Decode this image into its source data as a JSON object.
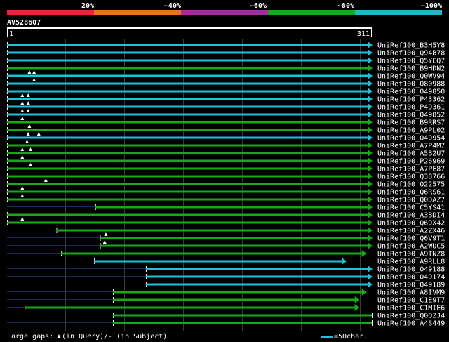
{
  "identity_scale": {
    "labels": [
      "20%",
      "~40%",
      "~60%",
      "~80%",
      "~100%"
    ],
    "colors": [
      "#e8243c",
      "#e07820",
      "#a02ca0",
      "#18a818",
      "#20b8c8"
    ]
  },
  "query": {
    "name": "AV528607",
    "start_label": "1",
    "end_label": "311",
    "length": 311
  },
  "hits": [
    {
      "name": "UniRef100_B3H5Y8",
      "start": 1,
      "end": 311,
      "color": "cyan",
      "arrow": true,
      "gaps": []
    },
    {
      "name": "UniRef100_Q94B78",
      "start": 1,
      "end": 311,
      "color": "cyan",
      "arrow": true,
      "gaps": []
    },
    {
      "name": "UniRef100_Q5YEQ7",
      "start": 1,
      "end": 311,
      "color": "cyan",
      "arrow": true,
      "gaps": []
    },
    {
      "name": "UniRef100_B9HDN2",
      "start": 1,
      "end": 311,
      "color": "green",
      "arrow": true,
      "gaps": []
    },
    {
      "name": "UniRef100_Q0WV94",
      "start": 1,
      "end": 311,
      "color": "cyan",
      "arrow": true,
      "gaps": [
        20,
        24
      ]
    },
    {
      "name": "UniRef100_O80988",
      "start": 1,
      "end": 311,
      "color": "cyan",
      "arrow": true,
      "gaps": [
        24
      ]
    },
    {
      "name": "UniRef100_O49850",
      "start": 1,
      "end": 311,
      "color": "cyan",
      "arrow": true,
      "gaps": []
    },
    {
      "name": "UniRef100_P43362",
      "start": 1,
      "end": 311,
      "color": "cyan",
      "arrow": true,
      "gaps": [
        14,
        19
      ]
    },
    {
      "name": "UniRef100_P49361",
      "start": 1,
      "end": 311,
      "color": "cyan",
      "arrow": true,
      "gaps": [
        14,
        19
      ]
    },
    {
      "name": "UniRef100_O49852",
      "start": 1,
      "end": 311,
      "color": "cyan",
      "arrow": true,
      "gaps": [
        14,
        19
      ]
    },
    {
      "name": "UniRef100_B9RRS7",
      "start": 1,
      "end": 311,
      "color": "green",
      "arrow": true,
      "gaps": [
        14
      ]
    },
    {
      "name": "UniRef100_A9PL02",
      "start": 1,
      "end": 311,
      "color": "green",
      "arrow": true,
      "gaps": [
        20
      ]
    },
    {
      "name": "UniRef100_O49954",
      "start": 1,
      "end": 311,
      "color": "cyan",
      "arrow": true,
      "gaps": [
        19,
        28
      ]
    },
    {
      "name": "UniRef100_A7P4M7",
      "start": 1,
      "end": 311,
      "color": "green",
      "arrow": true,
      "gaps": [
        18
      ]
    },
    {
      "name": "UniRef100_A5B2U7",
      "start": 1,
      "end": 311,
      "color": "green",
      "arrow": true,
      "gaps": [
        14,
        21
      ]
    },
    {
      "name": "UniRef100_P26969",
      "start": 1,
      "end": 311,
      "color": "green",
      "arrow": true,
      "gaps": [
        14
      ]
    },
    {
      "name": "UniRef100_A7PE87",
      "start": 1,
      "end": 311,
      "color": "green",
      "arrow": true,
      "gaps": [
        21
      ]
    },
    {
      "name": "UniRef100_Q38766",
      "start": 1,
      "end": 311,
      "color": "green",
      "arrow": true,
      "gaps": []
    },
    {
      "name": "UniRef100_O22575",
      "start": 1,
      "end": 311,
      "color": "green",
      "arrow": true,
      "gaps": [
        34
      ]
    },
    {
      "name": "UniRef100_Q6RS61",
      "start": 1,
      "end": 311,
      "color": "green",
      "arrow": true,
      "gaps": [
        14
      ]
    },
    {
      "name": "UniRef100_Q0DAZ7",
      "start": 1,
      "end": 311,
      "color": "green",
      "arrow": true,
      "gaps": [
        14
      ]
    },
    {
      "name": "UniRef100_C5YS41",
      "start": 76,
      "end": 311,
      "color": "green",
      "arrow": true,
      "gaps": []
    },
    {
      "name": "UniRef100_A3BDI4",
      "start": 1,
      "end": 311,
      "color": "green",
      "arrow": true,
      "gaps": []
    },
    {
      "name": "UniRef100_Q69X42",
      "start": 1,
      "end": 311,
      "color": "green",
      "arrow": true,
      "gaps": [
        14
      ]
    },
    {
      "name": "UniRef100_A2ZX46",
      "start": 43,
      "end": 311,
      "color": "green",
      "arrow": true,
      "gaps": []
    },
    {
      "name": "UniRef100_Q6V9T1",
      "start": 80,
      "end": 311,
      "color": "green",
      "arrow": true,
      "gaps": [
        85
      ]
    },
    {
      "name": "UniRef100_A2WUC5",
      "start": 80,
      "end": 311,
      "color": "green",
      "arrow": true,
      "gaps": [
        84
      ]
    },
    {
      "name": "UniRef100_A9TNZ8",
      "start": 47,
      "end": 306,
      "color": "green",
      "arrow": true,
      "gaps": []
    },
    {
      "name": "UniRef100_A9RLL8",
      "start": 75,
      "end": 289,
      "color": "cyan",
      "arrow": true,
      "gaps": []
    },
    {
      "name": "UniRef100_O49188",
      "start": 119,
      "end": 311,
      "color": "cyan",
      "arrow": true,
      "gaps": []
    },
    {
      "name": "UniRef100_O49174",
      "start": 119,
      "end": 311,
      "color": "cyan",
      "arrow": true,
      "gaps": []
    },
    {
      "name": "UniRef100_O49189",
      "start": 119,
      "end": 311,
      "color": "cyan",
      "arrow": true,
      "gaps": []
    },
    {
      "name": "UniRef100_A8IVM9",
      "start": 91,
      "end": 306,
      "color": "green",
      "arrow": true,
      "gaps": []
    },
    {
      "name": "UniRef100_C1E9T7",
      "start": 91,
      "end": 300,
      "color": "green",
      "arrow": true,
      "gaps": []
    },
    {
      "name": "UniRef100_C1MIE6",
      "start": 16,
      "end": 300,
      "color": "green",
      "arrow": true,
      "gaps": []
    },
    {
      "name": "UniRef100_Q0QZJ4",
      "start": 91,
      "end": 311,
      "color": "green",
      "arrow": false,
      "gaps": []
    },
    {
      "name": "UniRef100_A4S449",
      "start": 91,
      "end": 311,
      "color": "green",
      "arrow": false,
      "gaps": []
    }
  ],
  "legend": {
    "gaps_label": "Large gaps:",
    "query_gap": "(in Query)",
    "subject_gap": "/- (in Subject)",
    "scale_label": "=50char."
  },
  "colors": {
    "cyan": "#20c0d8",
    "green": "#18a818",
    "gridline": "#3a3a3a",
    "background": "#000000"
  }
}
